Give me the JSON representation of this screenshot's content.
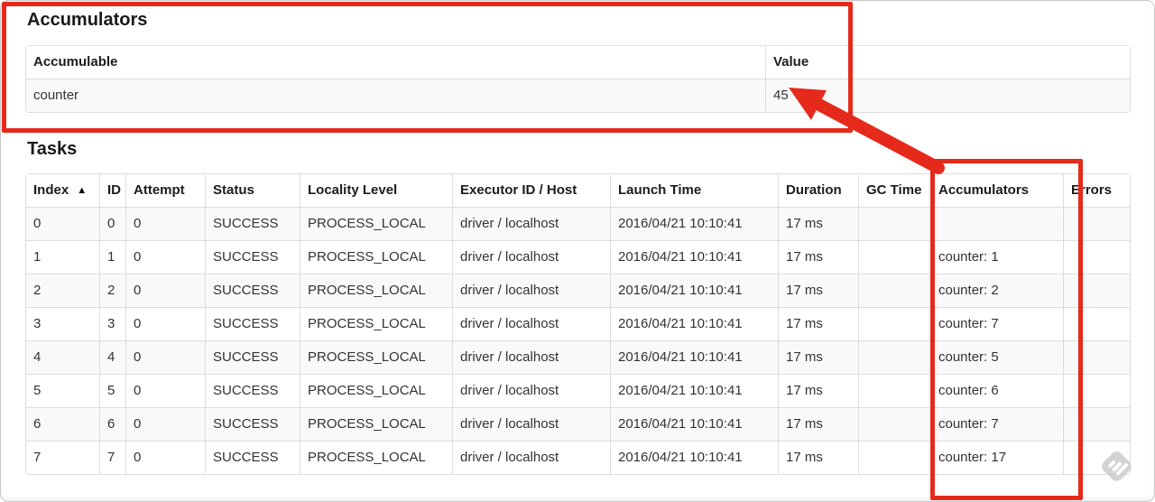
{
  "accumulators_section": {
    "title": "Accumulators",
    "columns": [
      "Accumulable",
      "Value"
    ],
    "rows": [
      [
        "counter",
        "45"
      ]
    ]
  },
  "tasks_section": {
    "title": "Tasks",
    "sort_column": "Index",
    "sort_icon": "▲",
    "columns": [
      "Index",
      "ID",
      "Attempt",
      "Status",
      "Locality Level",
      "Executor ID / Host",
      "Launch Time",
      "Duration",
      "GC Time",
      "Accumulators",
      "Errors"
    ],
    "rows": [
      [
        "0",
        "0",
        "0",
        "SUCCESS",
        "PROCESS_LOCAL",
        "driver / localhost",
        "2016/04/21 10:10:41",
        "17 ms",
        "",
        "",
        ""
      ],
      [
        "1",
        "1",
        "0",
        "SUCCESS",
        "PROCESS_LOCAL",
        "driver / localhost",
        "2016/04/21 10:10:41",
        "17 ms",
        "",
        "counter: 1",
        ""
      ],
      [
        "2",
        "2",
        "0",
        "SUCCESS",
        "PROCESS_LOCAL",
        "driver / localhost",
        "2016/04/21 10:10:41",
        "17 ms",
        "",
        "counter: 2",
        ""
      ],
      [
        "3",
        "3",
        "0",
        "SUCCESS",
        "PROCESS_LOCAL",
        "driver / localhost",
        "2016/04/21 10:10:41",
        "17 ms",
        "",
        "counter: 7",
        ""
      ],
      [
        "4",
        "4",
        "0",
        "SUCCESS",
        "PROCESS_LOCAL",
        "driver / localhost",
        "2016/04/21 10:10:41",
        "17 ms",
        "",
        "counter: 5",
        ""
      ],
      [
        "5",
        "5",
        "0",
        "SUCCESS",
        "PROCESS_LOCAL",
        "driver / localhost",
        "2016/04/21 10:10:41",
        "17 ms",
        "",
        "counter: 6",
        ""
      ],
      [
        "6",
        "6",
        "0",
        "SUCCESS",
        "PROCESS_LOCAL",
        "driver / localhost",
        "2016/04/21 10:10:41",
        "17 ms",
        "",
        "counter: 7",
        ""
      ],
      [
        "7",
        "7",
        "0",
        "SUCCESS",
        "PROCESS_LOCAL",
        "driver / localhost",
        "2016/04/21 10:10:41",
        "17 ms",
        "",
        "counter: 17",
        ""
      ]
    ]
  },
  "annotations": {
    "highlight_color": "#e52a1b",
    "arrow_points_to": "45"
  },
  "watermark": {
    "color": "#cccccc"
  }
}
